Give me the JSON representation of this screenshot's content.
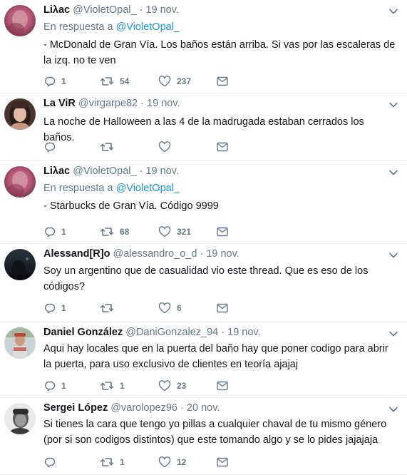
{
  "reply_prefix": "En respuesta a",
  "tweets": [
    {
      "name": "Liλac",
      "handle": "@VioletOpal_",
      "dot": "·",
      "time": "19 nov.",
      "reply_to": "@VioletOpal_",
      "text": "- McDonald de Gran Vía. Los baños están arriba. Si vas por las escaleras de la izq. no te ven",
      "replies": "1",
      "retweets": "54",
      "likes": "237",
      "avatar": "pink-blurred-photo"
    },
    {
      "name": "La ViR",
      "handle": "@virgarpe82",
      "dot": "·",
      "time": "19 nov.",
      "reply_to": "",
      "text": "La noche de Halloween a las 4 de la madrugada estaban cerrados los baños.",
      "replies": "",
      "retweets": "",
      "likes": "",
      "avatar": "woman-dark-hair-photo"
    },
    {
      "name": "Liλac",
      "handle": "@VioletOpal_",
      "dot": "·",
      "time": "19 nov.",
      "reply_to": "@VioletOpal_",
      "text": "- Starbucks de Gran Vía. Código 9999",
      "replies": "1",
      "retweets": "68",
      "likes": "321",
      "avatar": "pink-blurred-photo"
    },
    {
      "name": "Alessand[R]o",
      "handle": "@alessandro_o_d",
      "dot": "·",
      "time": "19 nov.",
      "reply_to": "",
      "text": "Soy un argentino que de casualidad vio este thread. Que es eso de los códigos?",
      "replies": "1",
      "retweets": "",
      "likes": "6",
      "avatar": "dark-night-photo"
    },
    {
      "name": "Daniel González",
      "handle": "@DaniGonzalez_94",
      "dot": "·",
      "time": "19 nov.",
      "reply_to": "",
      "text": "Aqui hay locales que en la puerta del baño hay que poner codigo para abrir la puerta, para uso exclusivo de clientes en teoría ajajaj",
      "replies": "1",
      "retweets": "1",
      "likes": "23",
      "avatar": "man-outdoor-photo"
    },
    {
      "name": "Sergei López",
      "handle": "@varolopez96",
      "dot": "·",
      "time": "20 nov.",
      "reply_to": "",
      "text": "Si tienes la cara que tengo yo pillas a cualquier chaval de tu mismo género (por si son codigos distintos) que este tomando algo y se lo pides jajajaja",
      "replies": "",
      "retweets": "1",
      "likes": "12",
      "avatar": "bw-portrait-photo"
    }
  ],
  "colors": {
    "text": "#14171a",
    "muted": "#657786",
    "link": "#1b95e0",
    "border": "#e6ecf0"
  }
}
